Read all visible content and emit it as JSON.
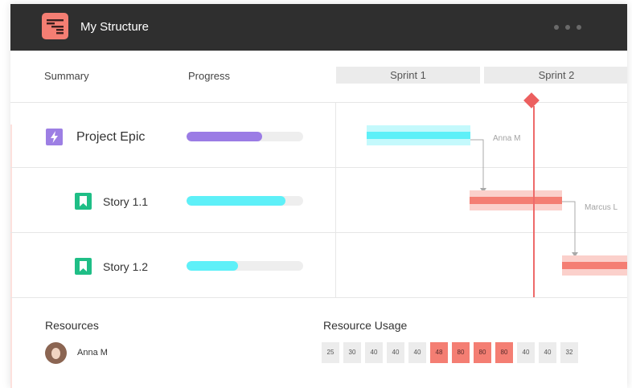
{
  "app": {
    "title": "My Structure",
    "logo_icon": "structure-icon"
  },
  "columns": {
    "summary": "Summary",
    "progress": "Progress",
    "sprints": [
      "Sprint 1",
      "Sprint 2"
    ]
  },
  "rows": [
    {
      "label": "Project Epic",
      "icon": "lightning-icon",
      "icon_color": "#9d7fe4",
      "progress": 0.65,
      "progress_color": "#9b7ce5",
      "assignee": "Anna M",
      "bar_color": "#5ef0f8"
    },
    {
      "label": "Story 1.1",
      "icon": "bookmark-icon",
      "icon_color": "#1fbe86",
      "progress": 0.85,
      "progress_color": "#5ef0f8",
      "assignee": "Marcus L",
      "bar_color": "#f47e73"
    },
    {
      "label": "Story 1.2",
      "icon": "bookmark-icon",
      "icon_color": "#1fbe86",
      "progress": 0.44,
      "progress_color": "#5ef0f8",
      "assignee": "",
      "bar_color": "#f47e73"
    }
  ],
  "resources": {
    "title": "Resources",
    "people": [
      {
        "name": "Anna M"
      }
    ]
  },
  "usage": {
    "title": "Resource Usage",
    "values": [
      "25",
      "30",
      "40",
      "40",
      "40",
      "48",
      "80",
      "80",
      "80",
      "40",
      "40",
      "32"
    ],
    "high_color": "#f47e73",
    "normal_color": "#ececec"
  },
  "colors": {
    "titlebar": "#2f2f2f",
    "today_line": "#ee6a6a"
  }
}
